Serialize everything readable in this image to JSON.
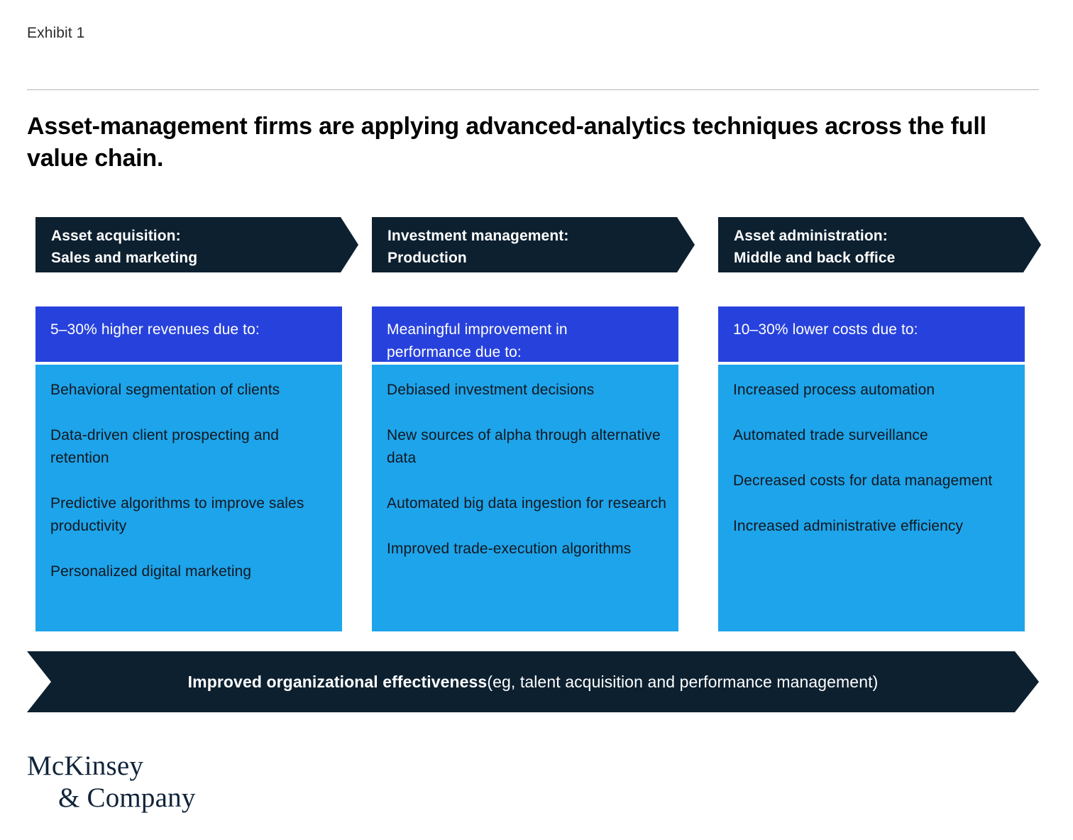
{
  "exhibit": {
    "label": "Exhibit 1"
  },
  "title": {
    "line1": "Asset-management firms are applying advanced-analytics techniques across",
    "line2": "the full value chain."
  },
  "colors": {
    "dark_navy": "#0d2030",
    "royal_blue": "#2742dc",
    "light_blue": "#1ea4ea",
    "rule": "#b3b6bb",
    "logo": "#10243a"
  },
  "columns": [
    {
      "header_line1": "Asset acquisition:",
      "header_line2": "Sales and marketing",
      "subheader_line1": "5–30% higher revenues due to:",
      "subheader_line2": "",
      "items": [
        "Behavioral segmentation of clients",
        "Data-driven client prospecting and retention",
        "Predictive algorithms to improve sales productivity",
        "Personalized digital marketing"
      ]
    },
    {
      "header_line1": "Investment management:",
      "header_line2": "Production",
      "subheader_line1": "Meaningful improvement in",
      "subheader_line2": "performance due to:",
      "items": [
        "Debiased investment decisions",
        "New sources of alpha through alternative data",
        "Automated big data ingestion for research",
        "Improved trade-execution algorithms"
      ]
    },
    {
      "header_line1": "Asset administration:",
      "header_line2": "Middle and back office",
      "subheader_line1": "10–30% lower costs due to:",
      "subheader_line2": "",
      "items": [
        "Increased process automation",
        "Automated trade surveillance",
        "Decreased costs for data management",
        "Increased administrative efficiency"
      ]
    }
  ],
  "banner": {
    "strong": "Improved organizational effectiveness",
    "rest": " (eg, talent acquisition and performance management)"
  },
  "logo": {
    "line1": "McKinsey",
    "line2": "& Company"
  }
}
